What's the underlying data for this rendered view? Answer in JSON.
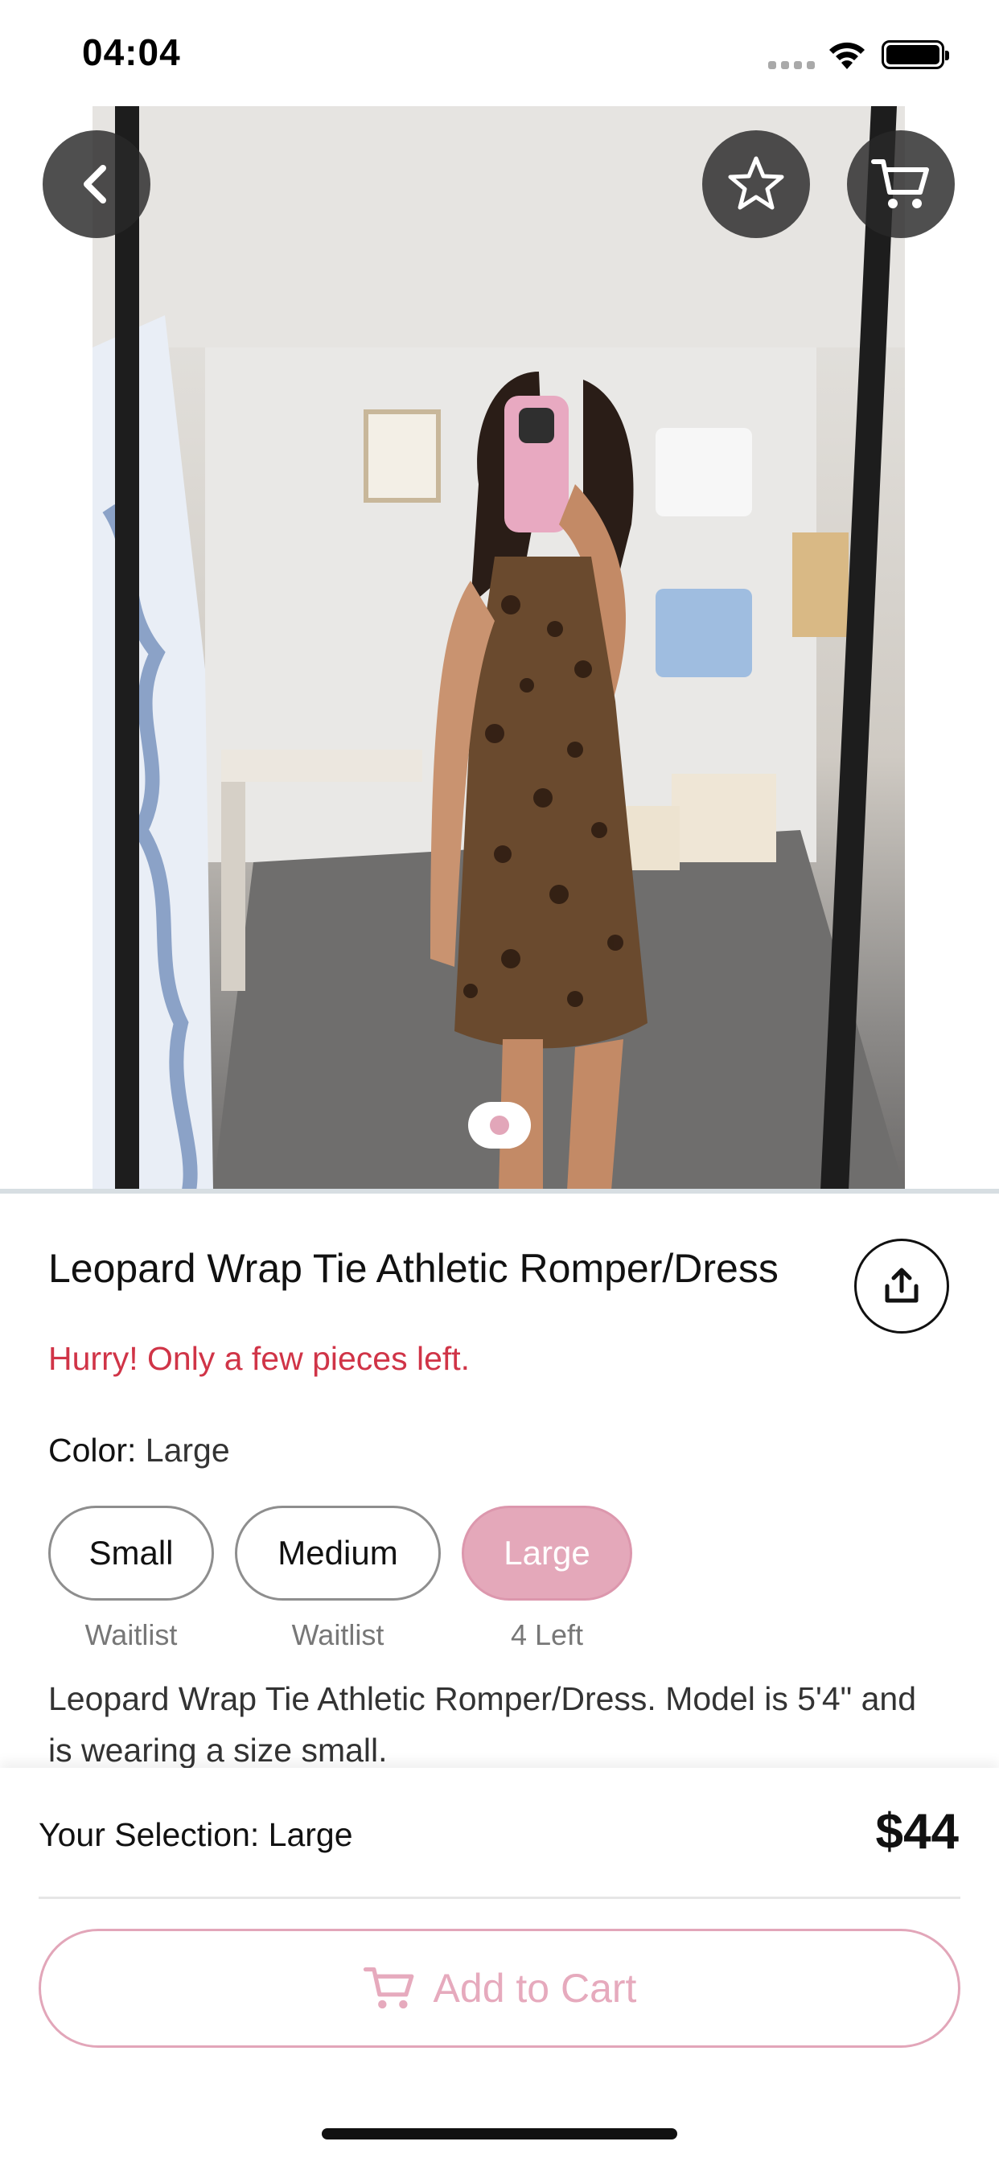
{
  "status_bar": {
    "time": "04:04"
  },
  "hero": {
    "image_alt": "Woman in leopard wrap romper taking mirror selfie in boutique",
    "page_count": 1,
    "current_page": 1
  },
  "nav": {
    "back_icon": "chevron-left-icon",
    "favorite_icon": "star-outline-icon",
    "cart_icon": "cart-icon"
  },
  "product": {
    "title": "Leopard Wrap Tie Athletic Romper/Dress",
    "urgency": "Hurry! Only a few pieces left.",
    "option_label": "Color:",
    "option_value": "Large",
    "sizes": [
      {
        "label": "Small",
        "status": "Waitlist",
        "selected": false
      },
      {
        "label": "Medium",
        "status": "Waitlist",
        "selected": false
      },
      {
        "label": "Large",
        "status": "4 Left",
        "selected": true
      }
    ],
    "description": "Leopard Wrap Tie Athletic Romper/Dress. Model is 5'4\" and is wearing a size small."
  },
  "footer": {
    "selection_label": "Your Selection: Large",
    "price": "$44",
    "add_to_cart": "Add to Cart"
  },
  "colors": {
    "accent_pink": "#e4a8ba",
    "urgency_red": "#d03447",
    "overlay_button": "#282828"
  }
}
